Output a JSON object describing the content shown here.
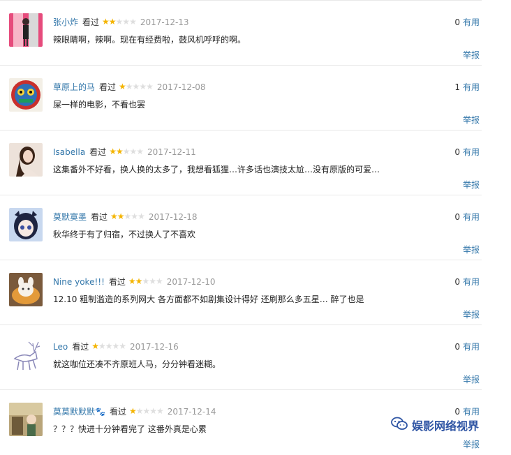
{
  "labels": {
    "watched": "看过",
    "useful_suffix": "有用",
    "report": "举报"
  },
  "colors": {
    "link": "#3377aa",
    "star_on": "#f4b400",
    "star_off": "#dedede",
    "date": "#999999"
  },
  "comments": [
    {
      "user": "张小炸",
      "stars": 2,
      "date": "2017-12-13",
      "useful": "0",
      "text": "辣眼睛啊，辣啊。现在有经费啦，鼓风机呼呼的啊。"
    },
    {
      "user": "草原上的马",
      "stars": 1,
      "date": "2017-12-08",
      "useful": "1",
      "text": "屎一样的电影，不看也罢"
    },
    {
      "user": "Isabella",
      "stars": 2,
      "date": "2017-12-11",
      "useful": "0",
      "text": "这集番外不好看，换人换的太多了，我想看狐狸…许多话也演技太尬…没有原版的可爱…"
    },
    {
      "user": "莫默寞墨",
      "stars": 2,
      "date": "2017-12-18",
      "useful": "0",
      "text": "秋华终于有了归宿，不过换人了不喜欢"
    },
    {
      "user": "Nine yoke!!!",
      "stars": 2,
      "date": "2017-12-10",
      "useful": "0",
      "text": "12.10 粗制滥造的系列网大 各方面都不如剧集设计得好 还刷那么多五星… 醉了也是"
    },
    {
      "user": "Leo",
      "stars": 1,
      "date": "2017-12-16",
      "useful": "0",
      "text": "就这咖位还凑不齐原班人马，分分钟看迷糊。"
    },
    {
      "user": "莫莫默默默🐾",
      "stars": 1,
      "date": "2017-12-14",
      "useful": "0",
      "text": "？？？快进十分钟看完了 这番外真是心累"
    }
  ],
  "watermark": {
    "text": "娱影网络视界",
    "icon": "wechat-icon"
  }
}
